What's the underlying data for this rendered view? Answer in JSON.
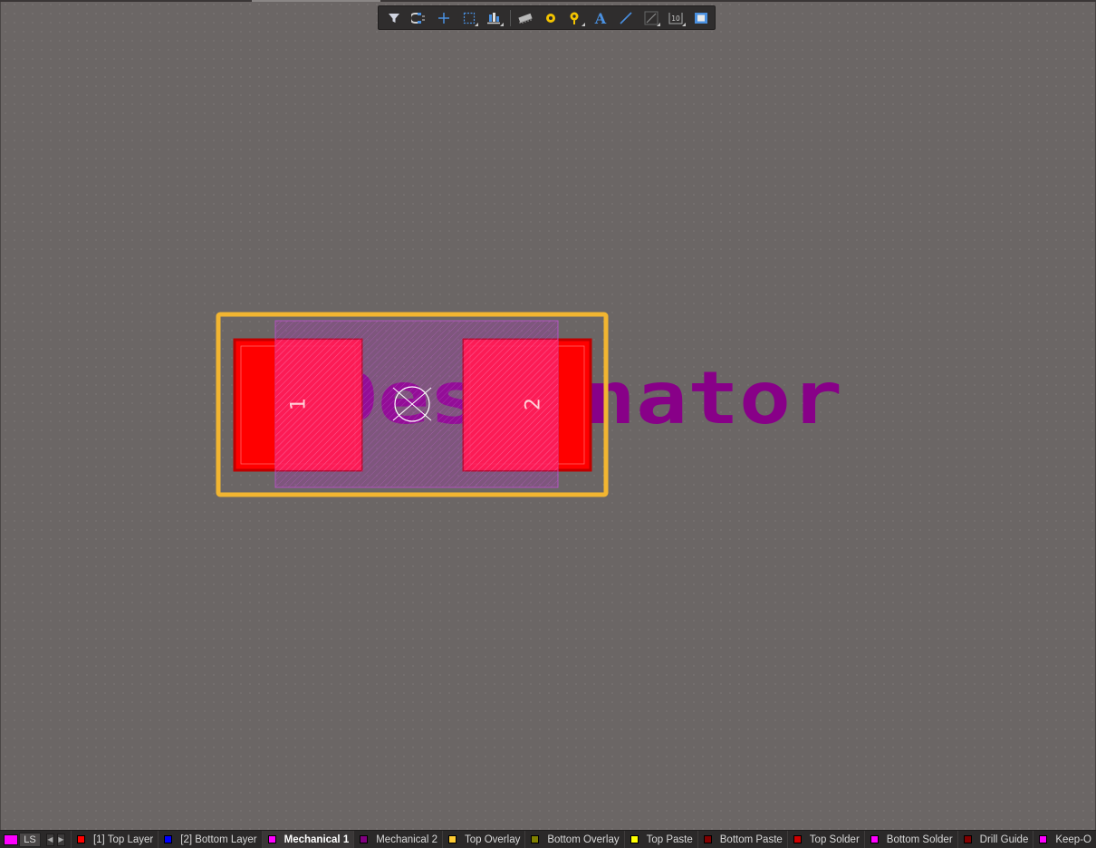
{
  "toolbar": {
    "buttons": [
      {
        "name": "filter-icon",
        "dropdown": false
      },
      {
        "name": "snap-magnet-icon",
        "dropdown": false
      },
      {
        "name": "crosshair-icon",
        "dropdown": false
      },
      {
        "name": "select-area-icon",
        "dropdown": true
      },
      {
        "name": "align-icon",
        "dropdown": true
      },
      {
        "name": "component-icon",
        "dropdown": false
      },
      {
        "name": "pad-icon",
        "dropdown": false
      },
      {
        "name": "via-icon",
        "dropdown": true
      },
      {
        "name": "text-icon",
        "dropdown": false
      },
      {
        "name": "line-icon",
        "dropdown": false
      },
      {
        "name": "dimension-icon",
        "dropdown": true
      },
      {
        "name": "string-icon",
        "dropdown": true
      },
      {
        "name": "region-icon",
        "dropdown": false
      }
    ],
    "text_glyph": "A",
    "string_glyph": "10"
  },
  "footprint": {
    "designator_text": "Designator",
    "pad1_label": "1",
    "pad2_label": "2",
    "colors": {
      "top_layer": "#ff0000",
      "top_overlay": "#f2b531",
      "mechanical": "#b030c0",
      "designator": "#880088",
      "pad_highlight": "#ff1f5a"
    }
  },
  "layerbar": {
    "ls_label": "LS",
    "ls_color": "#ff00ff",
    "tabs": [
      {
        "label": "[1] Top Layer",
        "color": "#ff0000",
        "active": false
      },
      {
        "label": "[2] Bottom Layer",
        "color": "#0000ff",
        "active": false
      },
      {
        "label": "Mechanical 1",
        "color": "#ff00ff",
        "active": true
      },
      {
        "label": "Mechanical 2",
        "color": "#800080",
        "active": false
      },
      {
        "label": "Top Overlay",
        "color": "#ffcc33",
        "active": false
      },
      {
        "label": "Bottom Overlay",
        "color": "#808000",
        "active": false
      },
      {
        "label": "Top Paste",
        "color": "#ffff00",
        "active": false
      },
      {
        "label": "Bottom Paste",
        "color": "#800000",
        "active": false
      },
      {
        "label": "Top Solder",
        "color": "#cc0000",
        "active": false
      },
      {
        "label": "Bottom Solder",
        "color": "#ff00ff",
        "active": false
      },
      {
        "label": "Drill Guide",
        "color": "#800000",
        "active": false
      },
      {
        "label": "Keep-O",
        "color": "#ff00ff",
        "active": false
      }
    ]
  }
}
